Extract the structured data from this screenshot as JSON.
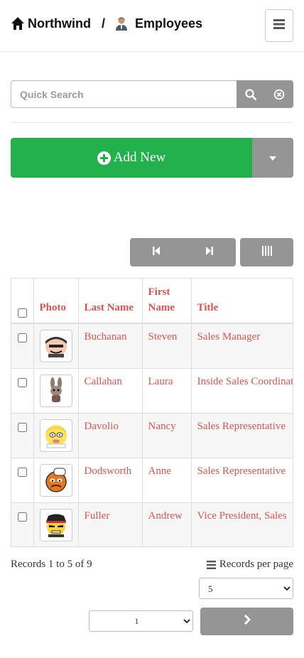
{
  "header": {
    "app_name": "Northwind",
    "separator": "/",
    "section": "Employees",
    "home_icon": "home-icon",
    "section_icon": "employee-icon",
    "menu_icon": "hamburger-menu-icon"
  },
  "search": {
    "placeholder": "Quick Search",
    "value": "",
    "search_icon": "search-icon",
    "clear_icon": "clear-icon"
  },
  "actions": {
    "add_new_label": "Add New",
    "add_icon": "plus-circle-icon",
    "dropdown_icon": "caret-down-icon",
    "accent_green": "#22b14c",
    "button_gray": "#959595"
  },
  "pager_top": {
    "first_icon": "first-page-icon",
    "last_icon": "last-page-icon",
    "columns_icon": "columns-icon"
  },
  "table": {
    "columns": [
      "Photo",
      "Last Name",
      "First Name",
      "Title"
    ],
    "rows": [
      {
        "last_name": "Buchanan",
        "first_name": "Steven",
        "title": "Sales Manager",
        "photo_icon": "employee-photo-icon"
      },
      {
        "last_name": "Callahan",
        "first_name": "Laura",
        "title": "Inside Sales Coordinator",
        "photo_icon": "employee-photo-icon"
      },
      {
        "last_name": "Davolio",
        "first_name": "Nancy",
        "title": "Sales Representative",
        "photo_icon": "employee-photo-icon"
      },
      {
        "last_name": "Dodsworth",
        "first_name": "Anne",
        "title": "Sales Representative",
        "photo_icon": "employee-photo-icon"
      },
      {
        "last_name": "Fuller",
        "first_name": "Andrew",
        "title": "Vice President, Sales",
        "photo_icon": "employee-photo-icon"
      }
    ],
    "link_color": "#d9534f"
  },
  "footer": {
    "records_info": "Records 1 to 5 of 9",
    "records_per_page_label": "Records per page",
    "records_per_page_value": "5",
    "page_value": "1",
    "next_icon": "chevron-right-icon"
  }
}
